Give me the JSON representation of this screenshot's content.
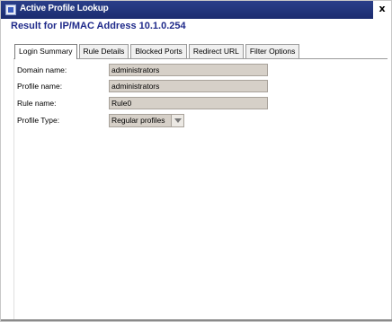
{
  "window": {
    "title": "Active Profile Lookup",
    "close_glyph": "x"
  },
  "header": {
    "result_text": "Result for IP/MAC Address 10.1.0.254"
  },
  "tabs": [
    {
      "label": "Login Summary",
      "active": true
    },
    {
      "label": "Rule Details",
      "active": false
    },
    {
      "label": "Blocked Ports",
      "active": false
    },
    {
      "label": "Redirect URL",
      "active": false
    },
    {
      "label": "Filter Options",
      "active": false
    }
  ],
  "login_summary": {
    "domain": {
      "label": "Domain name:",
      "value": "administrators"
    },
    "profile": {
      "label": "Profile name:",
      "value": "administrators"
    },
    "rule": {
      "label": "Rule name:",
      "value": "Rule0"
    },
    "profile_type": {
      "label": "Profile Type:",
      "value": "Regular profiles"
    }
  },
  "icons": {
    "app": "app-window-icon",
    "dropdown": "chevron-down-icon"
  },
  "colors": {
    "titlebar": "#1b2c6f",
    "header_text": "#1f2a8a",
    "field_bg": "#d6d0c8"
  }
}
